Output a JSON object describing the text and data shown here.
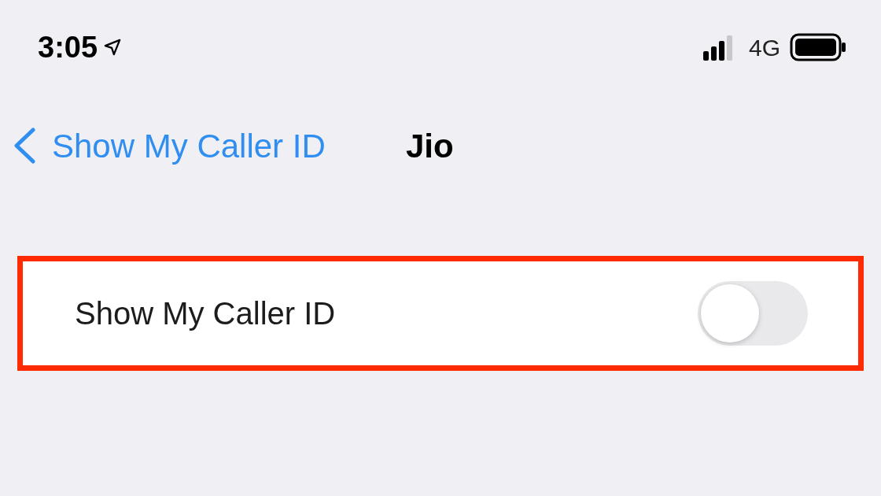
{
  "status_bar": {
    "time": "3:05",
    "network": "4G"
  },
  "nav": {
    "back_label": "Show My Caller ID",
    "title": "Jio"
  },
  "settings": [
    {
      "label": "Show My Caller ID",
      "on": false,
      "highlighted": true
    }
  ]
}
